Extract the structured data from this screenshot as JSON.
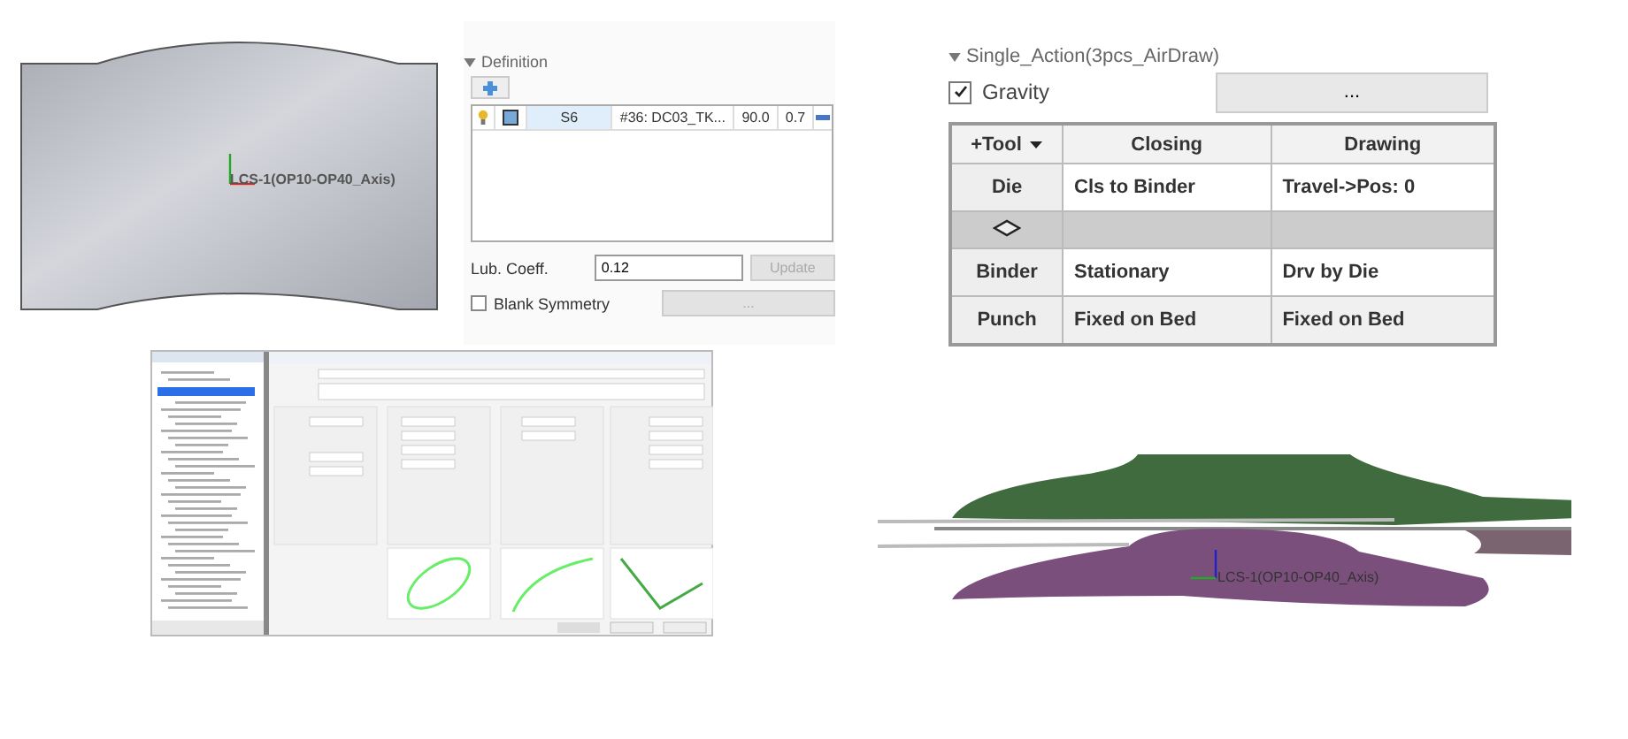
{
  "blank_view": {
    "axis_label": "LCS-1(OP10-OP40_Axis)"
  },
  "definition": {
    "title": "Definition",
    "expanded": true,
    "row": {
      "cells": [
        "S6",
        "#36: DC03_TK...",
        "90.0",
        "0.7"
      ]
    },
    "lub_coeff": {
      "label": "Lub. Coeff.",
      "value": "0.12",
      "button": "Update",
      "disabled": true
    },
    "blank_symmetry": {
      "label": "Blank Symmetry",
      "checked": false,
      "button": "...",
      "disabled": true
    }
  },
  "single_action": {
    "title": "Single_Action(3pcs_AirDraw)",
    "expanded": true,
    "gravity": {
      "label": "Gravity",
      "checked": true
    },
    "button": "...",
    "table": {
      "columns": [
        "+Tool",
        "Closing",
        "Drawing"
      ],
      "rows": [
        {
          "kind": "tool",
          "tool": "Die",
          "closing": "Cls to Binder",
          "drawing": "Travel->Pos: 0"
        },
        {
          "kind": "blank"
        },
        {
          "kind": "tool",
          "tool": "Binder",
          "closing": "Stationary",
          "drawing": "Drv by Die"
        },
        {
          "kind": "tool",
          "tool": "Punch",
          "closing": "Fixed on Bed",
          "drawing": "Fixed on Bed"
        }
      ]
    }
  },
  "tool_view": {
    "axis_label": "LCS-1(OP10-OP40_Axis)"
  }
}
